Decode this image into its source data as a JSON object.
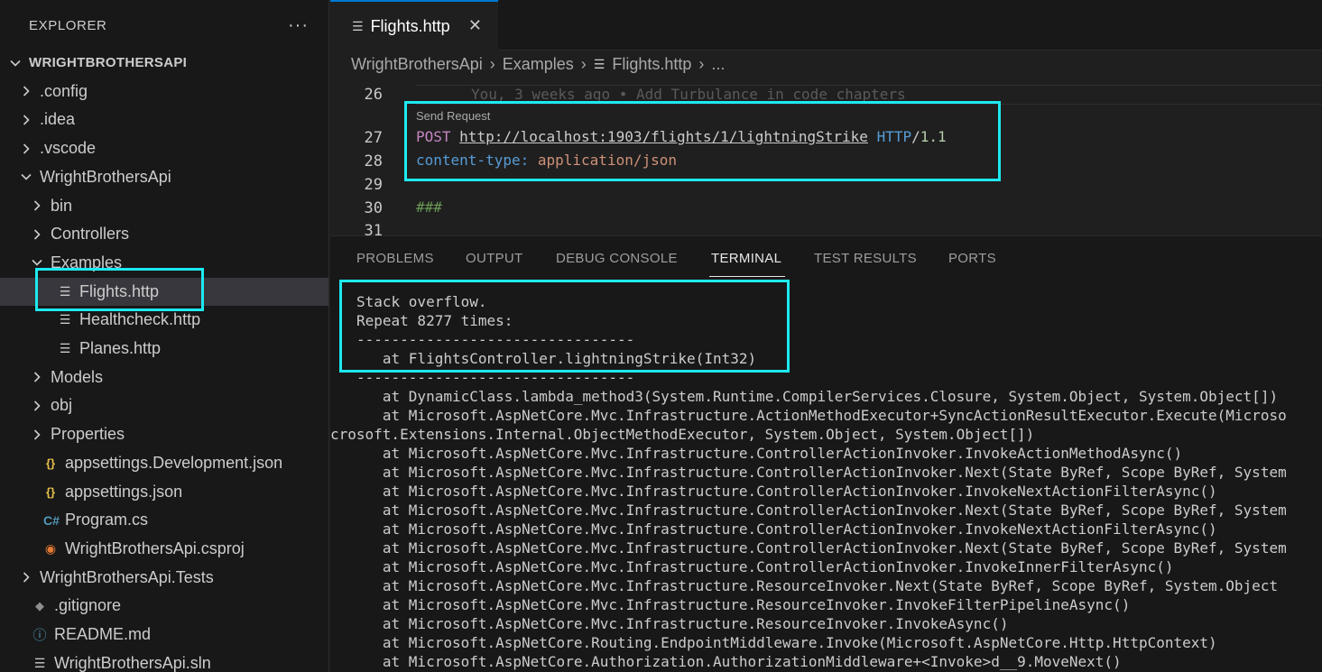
{
  "sidebar": {
    "title": "EXPLORER",
    "more": "···",
    "items": [
      {
        "label": "WRIGHTBROTHERSAPI",
        "depth": 0,
        "chevron": "down",
        "icon": "",
        "bold": true
      },
      {
        "label": ".config",
        "depth": 1,
        "chevron": "right",
        "icon": ""
      },
      {
        "label": ".idea",
        "depth": 1,
        "chevron": "right",
        "icon": ""
      },
      {
        "label": ".vscode",
        "depth": 1,
        "chevron": "right",
        "icon": ""
      },
      {
        "label": "WrightBrothersApi",
        "depth": 1,
        "chevron": "down",
        "icon": ""
      },
      {
        "label": "bin",
        "depth": 2,
        "chevron": "right",
        "icon": ""
      },
      {
        "label": "Controllers",
        "depth": 2,
        "chevron": "right",
        "icon": ""
      },
      {
        "label": "Examples",
        "depth": 2,
        "chevron": "down",
        "icon": ""
      },
      {
        "label": "Flights.http",
        "depth": 3,
        "chevron": "",
        "icon": "lines",
        "selected": true
      },
      {
        "label": "Healthcheck.http",
        "depth": 3,
        "chevron": "",
        "icon": "lines"
      },
      {
        "label": "Planes.http",
        "depth": 3,
        "chevron": "",
        "icon": "lines"
      },
      {
        "label": "Models",
        "depth": 2,
        "chevron": "right",
        "icon": ""
      },
      {
        "label": "obj",
        "depth": 2,
        "chevron": "right",
        "icon": ""
      },
      {
        "label": "Properties",
        "depth": 2,
        "chevron": "right",
        "icon": ""
      },
      {
        "label": "appsettings.Development.json",
        "depth": 2,
        "chevron": "",
        "icon": "json"
      },
      {
        "label": "appsettings.json",
        "depth": 2,
        "chevron": "",
        "icon": "json"
      },
      {
        "label": "Program.cs",
        "depth": 2,
        "chevron": "",
        "icon": "cs"
      },
      {
        "label": "WrightBrothersApi.csproj",
        "depth": 2,
        "chevron": "",
        "icon": "rss"
      },
      {
        "label": "WrightBrothersApi.Tests",
        "depth": 1,
        "chevron": "right",
        "icon": ""
      },
      {
        "label": ".gitignore",
        "depth": 1,
        "chevron": "",
        "icon": "git"
      },
      {
        "label": "README.md",
        "depth": 1,
        "chevron": "",
        "icon": "info"
      },
      {
        "label": "WrightBrothersApi.sln",
        "depth": 1,
        "chevron": "",
        "icon": "lines"
      }
    ]
  },
  "editor": {
    "tab_label": "Flights.http",
    "tab_close": "✕",
    "breadcrumb": [
      "WrightBrothersApi",
      "Examples",
      "Flights.http",
      "..."
    ],
    "blame": "You, 3 weeks ago • Add Turbulance in code chapters",
    "codelens": "Send Request",
    "lines": {
      "n26": "26",
      "n27": "27",
      "n28": "28",
      "n29": "29",
      "n30": "30",
      "n31": "31"
    },
    "request": {
      "method": "POST",
      "url": "http://localhost:1903/flights/1/lightningStrike",
      "proto": "HTTP",
      "slash": "/",
      "version": "1.1",
      "header_key": "content-type:",
      "header_value": "application/json",
      "separator": "###"
    }
  },
  "panel": {
    "tabs": [
      "PROBLEMS",
      "OUTPUT",
      "DEBUG CONSOLE",
      "TERMINAL",
      "TEST RESULTS",
      "PORTS"
    ],
    "active_tab": "TERMINAL",
    "terminal_lines": [
      "Stack overflow.",
      "Repeat 8277 times:",
      "--------------------------------",
      "   at FlightsController.lightningStrike(Int32)",
      "--------------------------------",
      "   at DynamicClass.lambda_method3(System.Runtime.CompilerServices.Closure, System.Object, System.Object[])",
      "   at Microsoft.AspNetCore.Mvc.Infrastructure.ActionMethodExecutor+SyncActionResultExecutor.Execute(Microso",
      "crosoft.Extensions.Internal.ObjectMethodExecutor, System.Object, System.Object[])",
      "   at Microsoft.AspNetCore.Mvc.Infrastructure.ControllerActionInvoker.InvokeActionMethodAsync()",
      "   at Microsoft.AspNetCore.Mvc.Infrastructure.ControllerActionInvoker.Next(State ByRef, Scope ByRef, System",
      "   at Microsoft.AspNetCore.Mvc.Infrastructure.ControllerActionInvoker.InvokeNextActionFilterAsync()",
      "   at Microsoft.AspNetCore.Mvc.Infrastructure.ControllerActionInvoker.Next(State ByRef, Scope ByRef, System",
      "   at Microsoft.AspNetCore.Mvc.Infrastructure.ControllerActionInvoker.InvokeNextActionFilterAsync()",
      "   at Microsoft.AspNetCore.Mvc.Infrastructure.ControllerActionInvoker.Next(State ByRef, Scope ByRef, System",
      "   at Microsoft.AspNetCore.Mvc.Infrastructure.ControllerActionInvoker.InvokeInnerFilterAsync()",
      "   at Microsoft.AspNetCore.Mvc.Infrastructure.ResourceInvoker.Next(State ByRef, Scope ByRef, System.Object",
      "   at Microsoft.AspNetCore.Mvc.Infrastructure.ResourceInvoker.InvokeFilterPipelineAsync()",
      "   at Microsoft.AspNetCore.Mvc.Infrastructure.ResourceInvoker.InvokeAsync()",
      "   at Microsoft.AspNetCore.Routing.EndpointMiddleware.Invoke(Microsoft.AspNetCore.Http.HttpContext)",
      "   at Microsoft.AspNetCore.Authorization.AuthorizationMiddleware+<Invoke>d__9.MoveNext()"
    ]
  },
  "colors": {
    "highlight": "#1de9f0",
    "accent": "#0078d4"
  }
}
